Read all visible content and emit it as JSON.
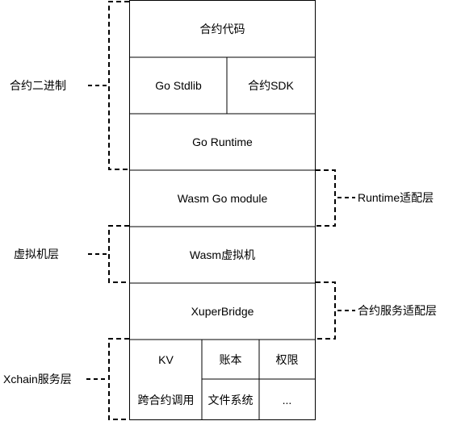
{
  "stack": {
    "contract_code": "合约代码",
    "go_stdlib": "Go Stdlib",
    "contract_sdk": "合约SDK",
    "go_runtime": "Go Runtime",
    "wasm_go_module": "Wasm Go module",
    "wasm_vm": "Wasm虚拟机",
    "xuper_bridge": "XuperBridge",
    "kv": "KV",
    "ledger": "账本",
    "permission": "权限",
    "cross_contract_call": "跨合约调用",
    "file_system": "文件系统",
    "more": "..."
  },
  "groups": {
    "contract_binary": "合约二进制",
    "runtime_adapter": "Runtime适配层",
    "vm_layer": "虚拟机层",
    "contract_service_adapter": "合约服务适配层",
    "xchain_service_layer": "Xchain服务层"
  },
  "colors": {
    "stroke": "#000000",
    "background": "#ffffff"
  }
}
